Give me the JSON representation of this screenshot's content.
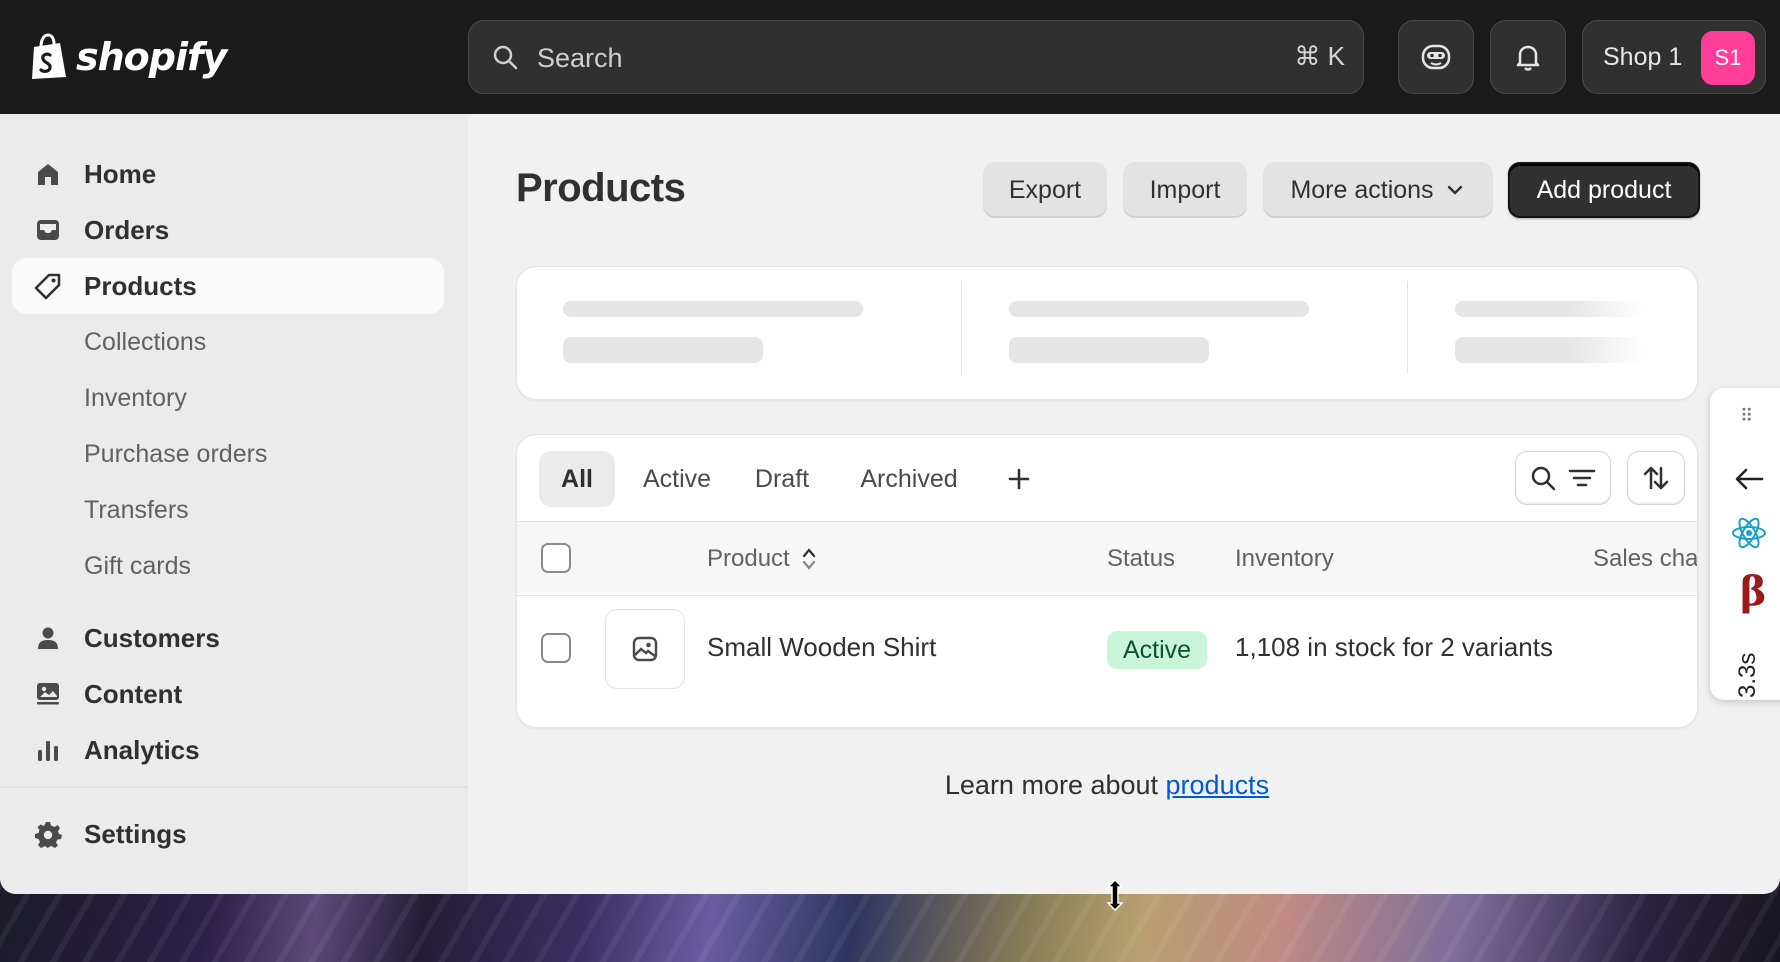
{
  "topbar": {
    "brand": "shopify",
    "search": {
      "placeholder": "Search",
      "shortcut": "⌘ K"
    },
    "shop": {
      "name": "Shop 1",
      "avatar": "S1"
    }
  },
  "sidebar": {
    "items": [
      {
        "label": "Home",
        "icon": "home-icon"
      },
      {
        "label": "Orders",
        "icon": "inbox-icon"
      },
      {
        "label": "Products",
        "icon": "tag-icon",
        "active": true
      },
      {
        "label": "Collections"
      },
      {
        "label": "Inventory"
      },
      {
        "label": "Purchase orders"
      },
      {
        "label": "Transfers"
      },
      {
        "label": "Gift cards"
      },
      {
        "label": "Customers",
        "icon": "person-icon"
      },
      {
        "label": "Content",
        "icon": "content-icon"
      },
      {
        "label": "Analytics",
        "icon": "bar-chart-icon"
      }
    ],
    "settings": "Settings"
  },
  "main": {
    "title": "Products",
    "actions": {
      "export": "Export",
      "import": "Import",
      "more": "More actions",
      "add": "Add product"
    },
    "tabs": [
      "All",
      "Active",
      "Draft",
      "Archived"
    ],
    "table": {
      "headers": {
        "product": "Product",
        "status": "Status",
        "inventory": "Inventory",
        "sales": "Sales cha"
      },
      "rows": [
        {
          "product": "Small Wooden Shirt",
          "status": "Active",
          "inventory": "1,108 in stock for 2 variants"
        }
      ]
    },
    "learn_prefix": "Learn more about ",
    "learn_link": "products"
  },
  "devpanel": {
    "time": "3.3s",
    "beta": "β"
  },
  "colors": {
    "accent": "#303030",
    "badge_active": "#c9f5d8",
    "avatar": "#ff3e9a",
    "link": "#005bd3"
  }
}
